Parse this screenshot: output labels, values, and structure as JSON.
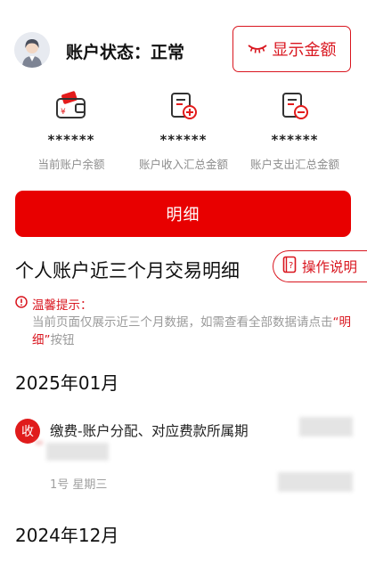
{
  "header": {
    "avatar": "user-avatar",
    "status_label": "账户状态：正常",
    "show_amount_button": "显示金额",
    "show_amount_icon": "eye-closed-icon"
  },
  "stats": [
    {
      "icon": "wallet-icon",
      "value": "******",
      "label": "当前账户余额"
    },
    {
      "icon": "income-document-icon",
      "value": "******",
      "label": "账户收入汇总金额"
    },
    {
      "icon": "expense-document-icon",
      "value": "******",
      "label": "账户支出汇总金额"
    }
  ],
  "detail_button": "明细",
  "section": {
    "title": "个人账户近三个月交易明细",
    "guide_button": "操作说明",
    "guide_icon": "guide-book-icon"
  },
  "tip": {
    "title": "温馨提示：",
    "body_prefix": "当前页面仅展示近三个月数据，如需查看全部数据请点击",
    "body_link": "“明细”",
    "body_suffix": "按钮"
  },
  "months": [
    {
      "label": "2025年01月",
      "transactions": [
        {
          "badge": "收",
          "title": "缴费-账户分配、对应费款所属期",
          "date": "1号 星期三"
        }
      ]
    },
    {
      "label": "2024年12月",
      "transactions": []
    }
  ],
  "colors": {
    "accent": "#e80000",
    "accent_text": "#d9161f",
    "muted": "#8d8d8d"
  }
}
